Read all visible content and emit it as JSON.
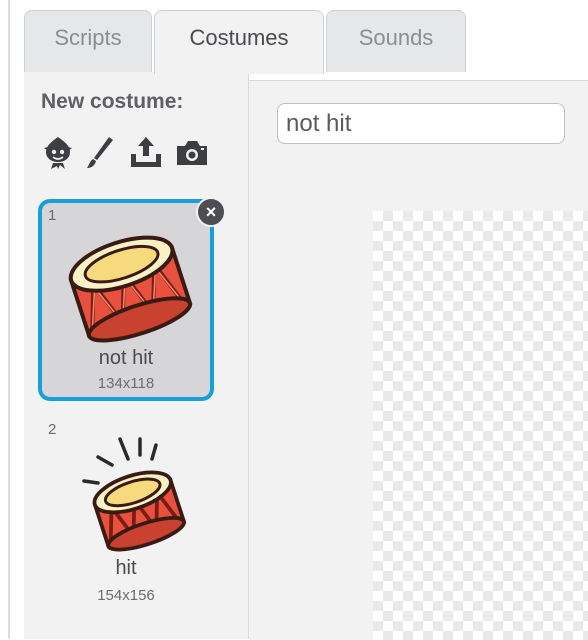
{
  "tabs": [
    {
      "label": "Scripts",
      "active": false
    },
    {
      "label": "Costumes",
      "active": true
    },
    {
      "label": "Sounds",
      "active": false
    }
  ],
  "sidebar": {
    "new_costume_label": "New costume:",
    "tools": [
      {
        "icon": "sprite-library-icon"
      },
      {
        "icon": "paintbrush-icon"
      },
      {
        "icon": "upload-icon"
      },
      {
        "icon": "camera-icon"
      }
    ],
    "costumes": [
      {
        "number": "1",
        "name": "not hit",
        "size": "134x118",
        "selected": true
      },
      {
        "number": "2",
        "name": "hit",
        "size": "154x156",
        "selected": false
      }
    ]
  },
  "editor": {
    "costume_name_value": "not hit"
  },
  "colors": {
    "selection_border": "#179fd7",
    "drum_red": "#e8513d",
    "drum_top": "#f7d97e"
  }
}
